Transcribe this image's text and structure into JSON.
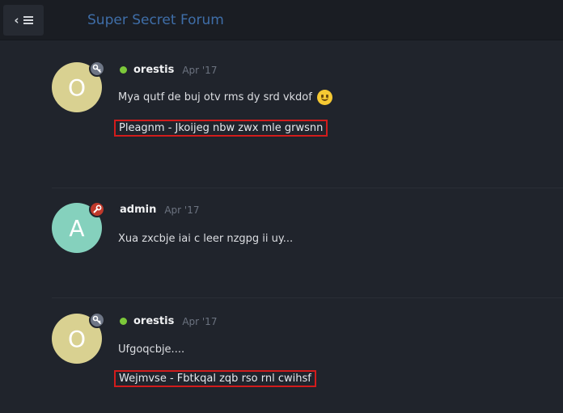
{
  "header": {
    "title": "Super Secret Forum",
    "back_icon": "chevron-left-icon",
    "menu_icon": "hamburger-icon"
  },
  "posts": [
    {
      "avatar_letter": "O",
      "avatar_color": "#d9d191",
      "badge_icon": "key-icon",
      "online": true,
      "username": "orestis",
      "date": "Apr '17",
      "text": "Mya qutf de buj otv rms dy srd vkdof",
      "emoji": "slightly-smiling-face-icon",
      "link": "Pleagnm - Jkoijeg nbw zwx mle grwsnn"
    },
    {
      "avatar_letter": "A",
      "avatar_color": "#85d1bd",
      "badge_icon": "wrench-icon",
      "online": false,
      "username": "admin",
      "date": "Apr '17",
      "text": "Xua zxcbje iai c leer nzgpg ii uy..."
    },
    {
      "avatar_letter": "O",
      "avatar_color": "#d9d191",
      "badge_icon": "key-icon",
      "online": true,
      "username": "orestis",
      "date": "Apr '17",
      "text": "Ufgoqcbje....",
      "link": "Wejmvse - Fbtkqal zqb rso rnl cwihsf"
    }
  ],
  "colors": {
    "background": "#20242c",
    "title": "#3f6ea8",
    "highlight_box": "#d21c1c",
    "online_dot": "#7cc83a",
    "admin_badge": "#c0392b"
  }
}
